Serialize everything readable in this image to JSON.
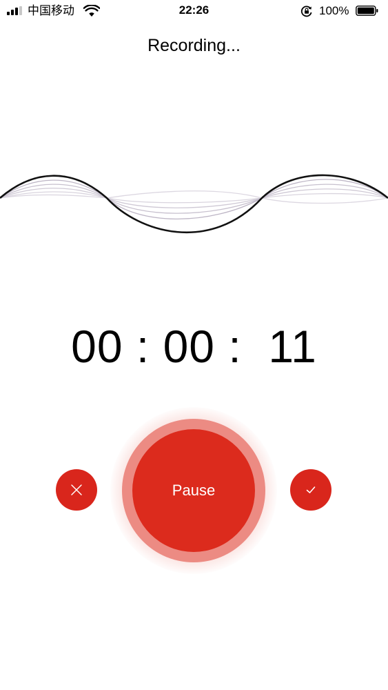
{
  "status_bar": {
    "carrier": "中国移动",
    "time": "22:26",
    "battery_percent": "100%",
    "icons": [
      "signal-icon",
      "wifi-icon",
      "rotation-lock-icon",
      "battery-icon"
    ]
  },
  "header": {
    "title": "Recording..."
  },
  "timer": {
    "display": "00 : 00 :  11"
  },
  "controls": {
    "cancel_icon": "close-icon",
    "pause_label": "Pause",
    "done_icon": "checkmark-icon"
  },
  "colors": {
    "accent": "#d9261c",
    "pause_ring": "#ec8b83",
    "waveform_main": "#111111",
    "waveform_faint": "#c9c3cf"
  }
}
